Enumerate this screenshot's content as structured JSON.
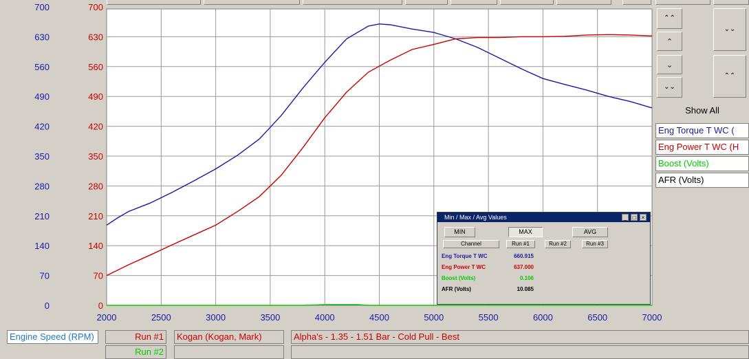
{
  "chart_data": {
    "type": "line",
    "x_axis": {
      "label": "Engine Speed (RPM)",
      "min": 2000,
      "max": 7000,
      "ticks": [
        2000,
        2500,
        3000,
        3500,
        4000,
        4500,
        5000,
        5500,
        6000,
        6500,
        7000
      ]
    },
    "y_axis_left": {
      "min": 0,
      "max": 700,
      "color": "#1a1aa8",
      "ticks": [
        0,
        70,
        140,
        210,
        280,
        350,
        420,
        490,
        560,
        630,
        700
      ]
    },
    "y_axis_right": {
      "min": 0,
      "max": 700,
      "color": "#cc0000",
      "ticks": [
        0,
        70,
        140,
        210,
        280,
        350,
        420,
        490,
        560,
        630,
        700
      ]
    },
    "grid": true,
    "series": [
      {
        "name": "Eng Torque T WC",
        "color": "#1a1aa8",
        "x": [
          2000,
          2100,
          2200,
          2400,
          2600,
          2800,
          3000,
          3200,
          3400,
          3600,
          3800,
          4000,
          4200,
          4400,
          4500,
          4600,
          4800,
          5000,
          5200,
          5400,
          5600,
          5800,
          6000,
          6200,
          6400,
          6600,
          6800,
          7000
        ],
        "y": [
          188,
          205,
          220,
          240,
          265,
          292,
          320,
          352,
          390,
          445,
          510,
          570,
          625,
          655,
          660,
          658,
          648,
          640,
          625,
          605,
          580,
          555,
          532,
          518,
          505,
          490,
          478,
          463
        ]
      },
      {
        "name": "Eng Power T WC",
        "color": "#cc0000",
        "x": [
          2000,
          2200,
          2400,
          2600,
          2800,
          3000,
          3200,
          3400,
          3600,
          3800,
          4000,
          4200,
          4400,
          4600,
          4800,
          5000,
          5200,
          5400,
          5600,
          5800,
          6000,
          6200,
          6400,
          6600,
          6800,
          7000
        ],
        "y": [
          70,
          95,
          118,
          142,
          165,
          188,
          220,
          255,
          305,
          370,
          440,
          500,
          547,
          575,
          600,
          612,
          625,
          628,
          628,
          630,
          630,
          631,
          634,
          635,
          634,
          632
        ]
      },
      {
        "name": "Boost (Volts)",
        "color": "#00cc00",
        "x": [
          2000,
          3800,
          4000,
          4300,
          4400,
          7000
        ],
        "y": [
          0,
          0,
          2,
          2,
          0,
          0
        ]
      }
    ]
  },
  "legend": {
    "show_all": "Show All",
    "items": [
      {
        "label": "Eng Torque T WC (",
        "color": "#1a1aa8"
      },
      {
        "label": "Eng Power T WC (H",
        "color": "#cc0000"
      },
      {
        "label": "Boost (Volts)",
        "color": "#00cc00"
      },
      {
        "label": "AFR (Volts)",
        "color": "#000000"
      }
    ]
  },
  "side_buttons": {
    "top": "⌃⌃",
    "up": "⌃",
    "down": "⌄",
    "bottom": "⌄⌄",
    "expand": "⌄⌄",
    "collapse": "⌃⌃"
  },
  "minmax": {
    "title": "Min / Max / Avg Values",
    "min_label": "MIN",
    "max_label": "MAX",
    "avg_label": "AVG",
    "col_channel": "Channel",
    "col_run1": "Run #1",
    "col_run2": "Run #2",
    "col_run3": "Run #3",
    "rows": [
      {
        "name": "Eng Torque T WC",
        "value": "660.915",
        "color": "#1a1aa8"
      },
      {
        "name": "Eng Power T WC",
        "value": "637.000",
        "color": "#cc0000"
      },
      {
        "name": "Boost (Volts)",
        "value": "0.106",
        "color": "#00cc00"
      },
      {
        "name": "AFR (Volts)",
        "value": "10.085",
        "color": "#000000"
      }
    ]
  },
  "bottom": {
    "axis_label": "Engine Speed (RPM)",
    "run1": "Run #1",
    "run2": "Run #2",
    "driver": "Kogan (Kogan, Mark)",
    "description": "Alpha's - 1.35 - 1.51 Bar  - Cold Pull - Best"
  }
}
